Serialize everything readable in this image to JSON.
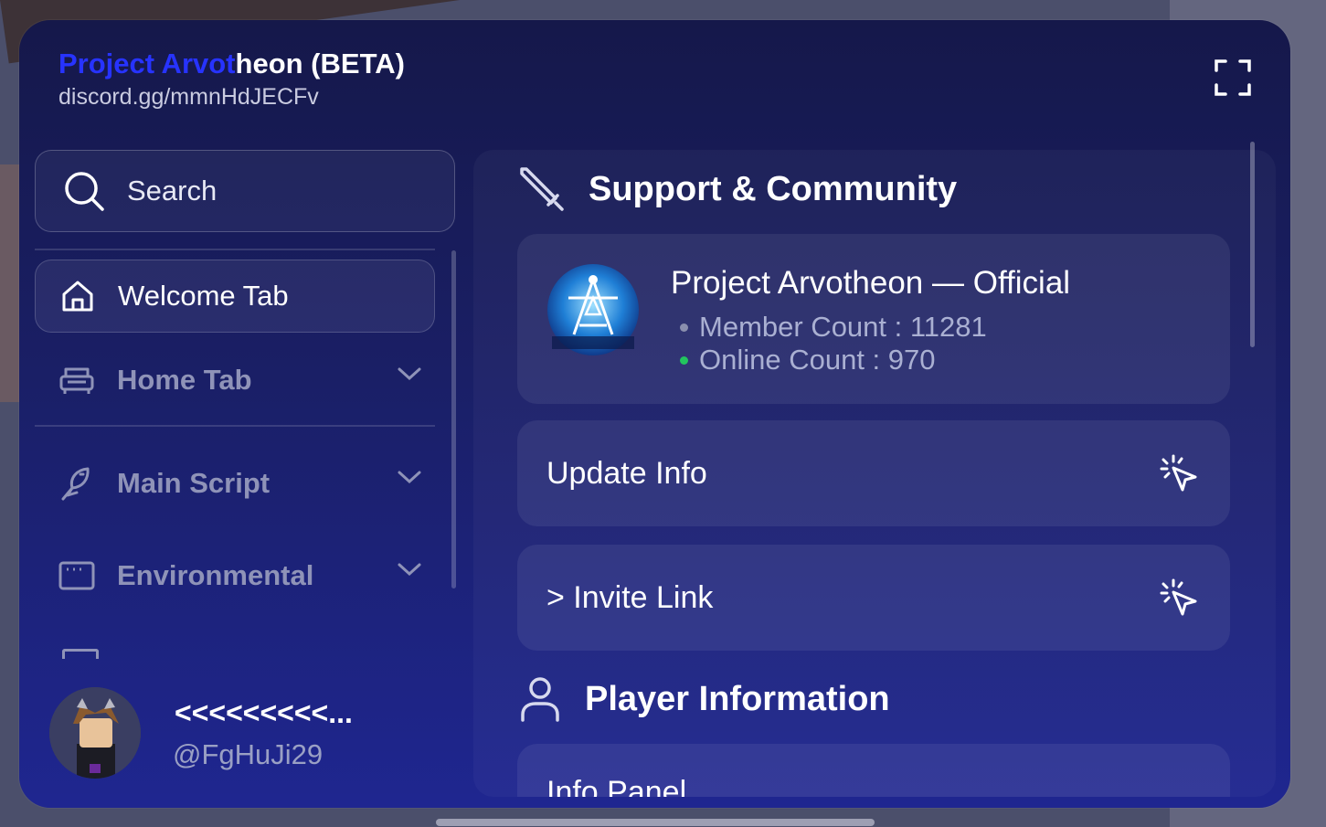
{
  "header": {
    "title_accent": "Project Arvot",
    "title_rest": "heon (BETA)",
    "subtitle": "discord.gg/mmnHdJECFv"
  },
  "search": {
    "placeholder": "Search"
  },
  "sidebar": {
    "items": [
      {
        "label": "Welcome Tab",
        "icon": "home-icon",
        "active": true
      },
      {
        "label": "Home Tab",
        "icon": "couch-icon",
        "expandable": true
      },
      {
        "label": "Main Script",
        "icon": "bird-icon",
        "expandable": true
      },
      {
        "label": "Environmental",
        "icon": "window-icon",
        "expandable": true
      }
    ]
  },
  "user": {
    "display_name": "<<<<<<<<<...",
    "handle": "@FgHuJi29"
  },
  "main": {
    "support_section": {
      "title": "Support & Community",
      "icon": "sword-icon"
    },
    "discord_card": {
      "server_name": "Project Arvotheon — Official",
      "member_count": "Member Count : 11281",
      "online_count": "Online Count : 970"
    },
    "update_button": {
      "label": "Update Info"
    },
    "invite_button": {
      "label": "> Invite Link"
    },
    "player_section": {
      "title": "Player Information",
      "icon": "user-icon"
    },
    "info_panel": {
      "label": "Info Panel"
    }
  },
  "colors": {
    "accent": "#2733ff",
    "member_dot": "#8a8fae",
    "online_dot": "#22c55e"
  }
}
